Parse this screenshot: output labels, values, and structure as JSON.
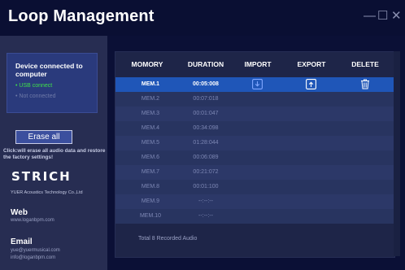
{
  "window": {
    "title": "Loop Management",
    "controls": {
      "minimize": "—",
      "maximize": "☐",
      "close": "✕"
    }
  },
  "sidebar": {
    "status_title": "Device connected to computer",
    "usb_status": "• USB connect",
    "not_connected": "• Not connected",
    "erase_label": "Erase all",
    "erase_note": "Click:will erase all audio data and restore the factory settings!",
    "brand_logo": "STRICH",
    "company": "YUER Acoustics Technology Co.,Ltd",
    "web_label": "Web",
    "web_url": "www.loganbpm.com",
    "email_label": "Email",
    "emails": [
      "yue@yuermusical.com",
      "info@loganbpm.com"
    ]
  },
  "table": {
    "headers": [
      "MOMORY",
      "DURATION",
      "IMPORT",
      "EXPORT",
      "DELETE"
    ],
    "rows": [
      {
        "name": "MEM.1",
        "duration": "00:05:008",
        "selected": true
      },
      {
        "name": "MEM.2",
        "duration": "00:07:018"
      },
      {
        "name": "MEM.3",
        "duration": "00:01:047"
      },
      {
        "name": "MEM.4",
        "duration": "00:34:098"
      },
      {
        "name": "MEM.5",
        "duration": "01:28:044"
      },
      {
        "name": "MEM.6",
        "duration": "00:06:089"
      },
      {
        "name": "MEM.7",
        "duration": "00:21:072"
      },
      {
        "name": "MEM.8",
        "duration": "00:01:100"
      },
      {
        "name": "MEM.9",
        "duration": "--:--:--"
      },
      {
        "name": "MEM.10",
        "duration": "--:--:--"
      }
    ],
    "footer": "Total 8 Recorded Audio"
  },
  "icons": {
    "import": "import-icon",
    "export": "export-icon",
    "delete": "trash-icon"
  },
  "colors": {
    "background": "#0b1036",
    "sidebar": "#272d52",
    "status_box": "#2a3a7c",
    "selected_row": "#1f56b8",
    "row": "#2c3868",
    "usb_connected": "#3fe04a"
  }
}
